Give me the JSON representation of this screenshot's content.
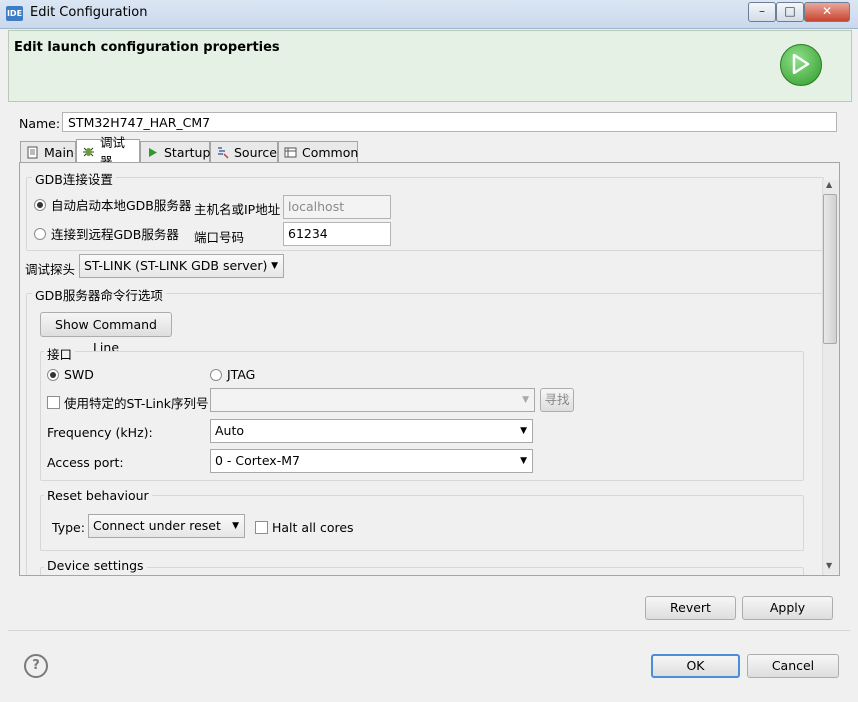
{
  "window": {
    "icon_text": "IDE",
    "title": "Edit Configuration",
    "min_glyph": "–",
    "max_glyph": "□",
    "close_glyph": "✕"
  },
  "header": {
    "title": "Edit launch configuration properties",
    "icon": "run-icon"
  },
  "name": {
    "label": "Name:",
    "value": "STM32H747_HAR_CM7"
  },
  "tabs": [
    {
      "label": "Main",
      "icon": "document-icon"
    },
    {
      "label": "调试器",
      "icon": "debug-bug-icon",
      "active": true
    },
    {
      "label": "Startup",
      "icon": "play-icon"
    },
    {
      "label": "Source",
      "icon": "source-icon"
    },
    {
      "label": "Common",
      "icon": "table-icon"
    }
  ],
  "gdb_connection": {
    "title": "GDB连接设置",
    "local_option": "自动启动本地GDB服务器",
    "remote_option": "连接到远程GDB服务器",
    "host_label": "主机名或IP地址",
    "host_value": "localhost",
    "port_label": "端口号码",
    "port_value": "61234"
  },
  "probe": {
    "label": "调试探头",
    "value": "ST-LINK (ST-LINK GDB server)"
  },
  "gdb_server_options": {
    "title": "GDB服务器命令行选项",
    "show_command_line_button": "Show Command Line",
    "interface": {
      "title": "接口",
      "swd_label": "SWD",
      "jtag_label": "JTAG",
      "serial_checkbox_label": "使用特定的ST-Link序列号",
      "serial_value": "",
      "scan_button": "寻找",
      "frequency_label": "Frequency (kHz):",
      "frequency_value": "Auto",
      "access_port_label": "Access port:",
      "access_port_value": "0 - Cortex-M7"
    },
    "reset": {
      "title": "Reset behaviour",
      "type_label": "Type:",
      "type_value": "Connect under reset",
      "halt_all_cores_label": "Halt all cores"
    },
    "device_settings_title": "Device settings"
  },
  "actions": {
    "revert": "Revert",
    "apply": "Apply",
    "ok": "OK",
    "cancel": "Cancel",
    "help": "?"
  }
}
